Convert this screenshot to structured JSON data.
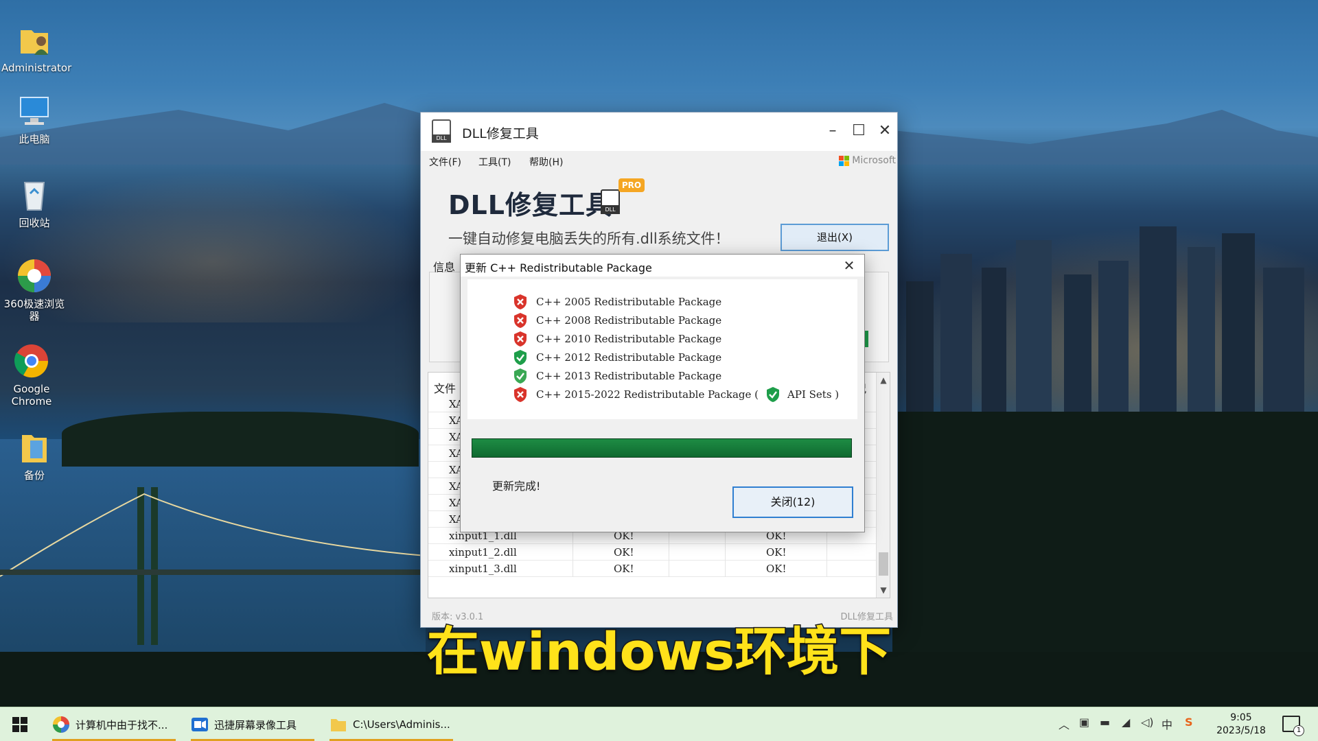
{
  "desktop": {
    "icons": [
      {
        "label": "Administrator",
        "icon": "user-folder-icon"
      },
      {
        "label": "此电脑",
        "icon": "computer-icon"
      },
      {
        "label": "回收站",
        "icon": "recycle-bin-icon"
      },
      {
        "label": "360极速浏览器",
        "icon": "360-browser-icon"
      },
      {
        "label": "Google Chrome",
        "icon": "chrome-icon"
      },
      {
        "label": "备份",
        "icon": "folder-icon"
      }
    ]
  },
  "window": {
    "title": "DLL修复工具",
    "menu": [
      "文件(F)",
      "工具(T)",
      "帮助(H)"
    ],
    "ms_label": "Microsoft",
    "brand_title": "DLL修复工具",
    "brand_badge": "PRO",
    "brand_icon_text": "DLL",
    "subtitle": "一键自动修复电脑丢失的所有.dll系统文件！",
    "exit_button": "退出(X)",
    "info_label": "信息",
    "table": {
      "header_left": "文件",
      "header_right": "况",
      "truncated_rows": [
        "XA",
        "XA",
        "XA",
        "XA",
        "XA",
        "XA",
        "XA",
        "XA"
      ],
      "rows": [
        {
          "file": "xinput1_1.dll",
          "status1": "OK!",
          "status2": "OK!"
        },
        {
          "file": "xinput1_2.dll",
          "status1": "OK!",
          "status2": "OK!"
        },
        {
          "file": "xinput1_3.dll",
          "status1": "OK!",
          "status2": "OK!"
        }
      ]
    },
    "version": "版本: v3.0.1",
    "footer_right": "DLL修复工具"
  },
  "dialog": {
    "title": "更新 C++ Redistributable Package",
    "packages": [
      {
        "name": "C++ 2005 Redistributable Package",
        "status": "error",
        "icon": "red-shield-x-icon"
      },
      {
        "name": "C++ 2008 Redistributable Package",
        "status": "error",
        "icon": "red-shield-x-icon"
      },
      {
        "name": "C++ 2010 Redistributable Package",
        "status": "error",
        "icon": "red-shield-x-icon"
      },
      {
        "name": "C++ 2012 Redistributable Package",
        "status": "ok",
        "icon": "green-shield-check-icon"
      },
      {
        "name": "C++ 2013 Redistributable Package",
        "status": "ok",
        "icon": "green-shield-check-icon"
      },
      {
        "name": "C++ 2015-2022 Redistributable Package (",
        "status": "error",
        "icon": "red-shield-x-icon",
        "extra": "API Sets )",
        "extra_status": "ok"
      }
    ],
    "progress": 1.0,
    "done_text": "更新完成!",
    "close_button": "关闭(12)"
  },
  "caption": "在windows环境下",
  "taskbar": {
    "items": [
      {
        "label": "计算机中由于找不...",
        "icon": "360-browser-icon"
      },
      {
        "label": "迅捷屏幕录像工具",
        "icon": "screen-recorder-icon"
      },
      {
        "label": "C:\\Users\\Adminis...",
        "icon": "folder-icon"
      }
    ],
    "ime": "中",
    "time": "9:05",
    "date": "2023/5/18",
    "notification_count": "1"
  },
  "colors": {
    "accent_blue": "#2f7fd1",
    "error_red": "#d9342b",
    "ok_green": "#1e9e4a",
    "caption_yellow": "#ffe21a",
    "taskbar_bg": "#dff2dc"
  }
}
